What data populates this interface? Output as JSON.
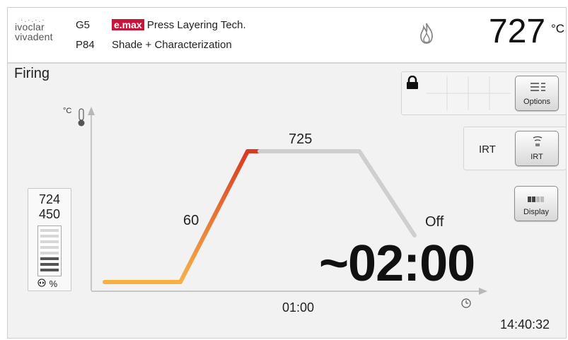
{
  "header": {
    "logo_line1": "ivoclar",
    "logo_line2": "vivadent",
    "code1": "G5",
    "code2": "P84",
    "brand": "e.max",
    "title_suffix": "Press Layering Tech.",
    "subtitle": "Shade + Characterization",
    "temperature": "727",
    "temperature_unit": "°C",
    "flame_icon": "flame-icon"
  },
  "page": {
    "title": "Firing"
  },
  "controls": {
    "options_label": "Options",
    "irt_label": "IRT",
    "irt_button_label": "IRT",
    "display_label": "Display"
  },
  "gauge": {
    "value_top": "724",
    "value_bottom": "450",
    "unit": "%"
  },
  "program": {
    "rate_label": "60",
    "hold_temp_label": "725",
    "end_label": "Off",
    "hold_time_label": "01:00",
    "remaining_time": "~02:00",
    "clock": "14:40:32",
    "y_axis_unit": "°C"
  },
  "colors": {
    "brand_red": "#c8163a",
    "ramp_start": "#f6b24a",
    "ramp_end": "#d93a22",
    "cool_line": "#cfcfcf"
  }
}
